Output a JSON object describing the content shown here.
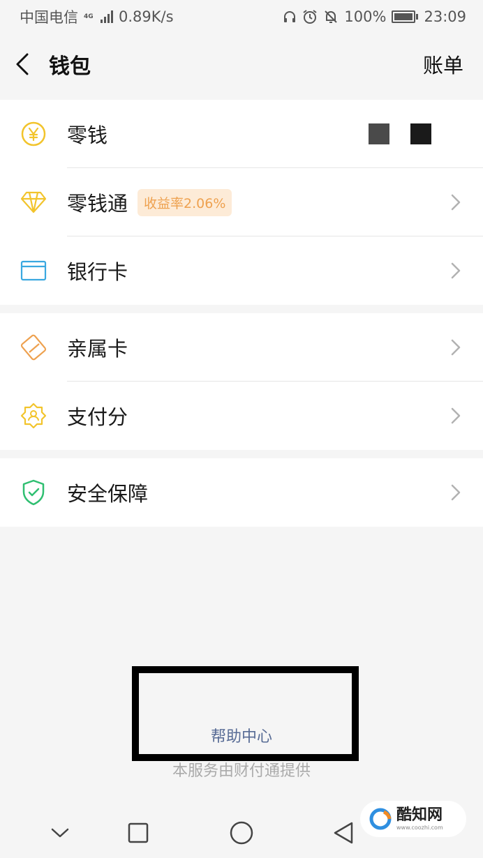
{
  "status_bar": {
    "carrier": "中国电信",
    "network": "4G",
    "speed": "0.89K/s",
    "battery": "100%",
    "time": "23:09"
  },
  "nav": {
    "title": "钱包",
    "action": "账单"
  },
  "groups": [
    {
      "items": [
        {
          "label": "零钱",
          "icon": "yuan-icon",
          "color": "#f2c42c"
        },
        {
          "label": "零钱通",
          "icon": "diamond-icon",
          "color": "#f2c42c",
          "badge": "收益率2.06%"
        },
        {
          "label": "银行卡",
          "icon": "card-icon",
          "color": "#3aa8e0"
        }
      ]
    },
    {
      "items": [
        {
          "label": "亲属卡",
          "icon": "family-card-icon",
          "color": "#eea14f"
        },
        {
          "label": "支付分",
          "icon": "score-badge-icon",
          "color": "#f2c42c"
        }
      ]
    },
    {
      "items": [
        {
          "label": "安全保障",
          "icon": "shield-icon",
          "color": "#2fbf71"
        }
      ]
    }
  ],
  "footer": {
    "help": "帮助中心",
    "provider": "本服务由财付通提供"
  },
  "watermark": {
    "name": "酷知网",
    "url": "www.coozhi.com"
  },
  "colors": {
    "background": "#f5f5f5",
    "link": "#576b95",
    "badge_bg": "#fdebd7",
    "badge_text": "#eea14f"
  }
}
